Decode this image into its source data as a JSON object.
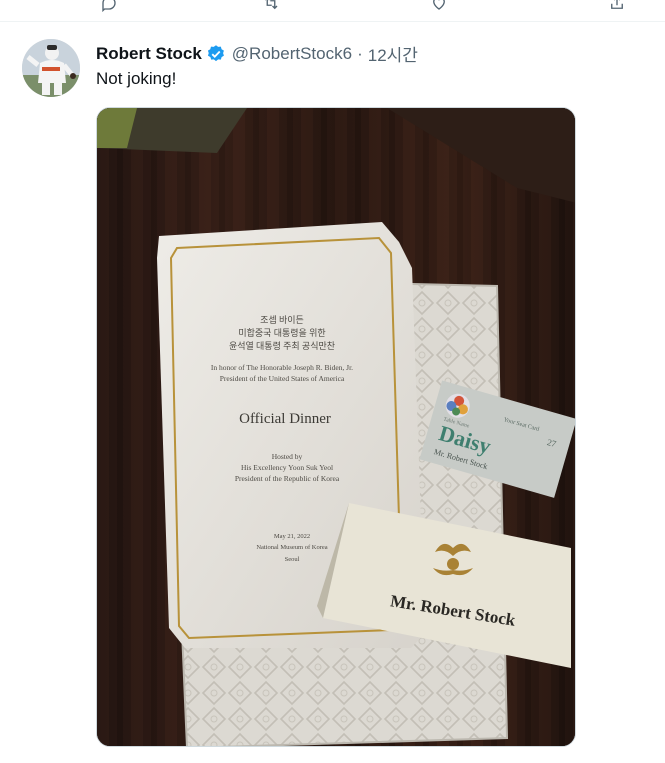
{
  "tweet": {
    "name": "Robert Stock",
    "handle": "@RobertStock6",
    "separator": "·",
    "time": "12시간",
    "text": "Not joking!"
  },
  "photo": {
    "menu_korean_1": "조셉 바이든",
    "menu_korean_2": "미합중국 대통령을 위한",
    "menu_korean_3": "윤석열 대통령 주최 공식만찬",
    "honor_line_1": "In honor of The Honorable Joseph R. Biden, Jr.",
    "honor_line_2": "President of the United States of America",
    "title": "Official Dinner",
    "hosted_1": "Hosted by",
    "hosted_2": "His Excellency Yoon Suk Yeol",
    "hosted_3": "President of the Republic of Korea",
    "date": "May 21, 2022",
    "venue_1": "National Museum of Korea",
    "venue_2": "Seoul",
    "seat_card_label": "Your Seat Card",
    "seat_number": "27",
    "table_name_label": "Table Name",
    "table_name": "Daisy",
    "seat_card_guest": "Mr. Robert Stock",
    "place_card_name": "Mr. Robert Stock"
  },
  "colors": {
    "verified": "#1d9bf0",
    "secondary_text": "#536471",
    "gold": "#b8923a"
  }
}
